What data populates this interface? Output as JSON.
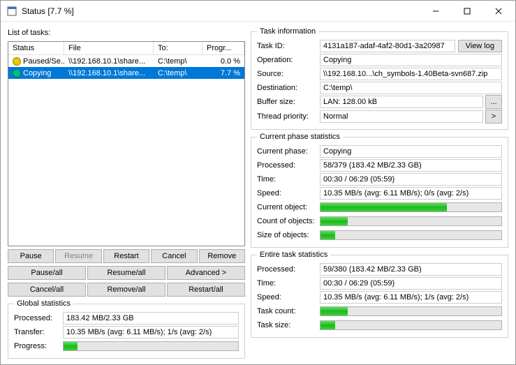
{
  "window": {
    "title": "Status [7.7 %]"
  },
  "tasksLabel": "List of tasks:",
  "listHeaders": {
    "status": "Status",
    "file": "File",
    "to": "To:",
    "progress": "Progr..."
  },
  "tasks": [
    {
      "status": "Paused/Se...",
      "file": "\\\\192.168.10.1\\share...",
      "to": "C:\\temp\\",
      "progress": "0.0 %",
      "state": "paused"
    },
    {
      "status": "Copying",
      "file": "\\\\192.168.10.1\\share...",
      "to": "C:\\temp\\",
      "progress": "7.7 %",
      "state": "copying"
    }
  ],
  "btns": {
    "pause": "Pause",
    "resume": "Resume",
    "restart": "Restart",
    "cancel": "Cancel",
    "remove": "Remove",
    "pauseAll": "Pause/all",
    "resumeAll": "Resume/all",
    "advanced": "Advanced >",
    "cancelAll": "Cancel/all",
    "removeAll": "Remove/all",
    "restartAll": "Restart/all"
  },
  "glob": {
    "legend": "Global statistics",
    "processedK": "Processed:",
    "processedV": "183.42 MB/2.33 GB",
    "transferK": "Transfer:",
    "transferV": "10.35 MB/s (avg: 6.11 MB/s); 1/s (avg: 2/s)",
    "progressK": "Progress:",
    "progressPct": 8
  },
  "info": {
    "legend": "Task information",
    "taskIdK": "Task ID:",
    "taskIdV": "4131a187-adaf-4af2-80d1-3a20987",
    "viewLog": "View log",
    "operationK": "Operation:",
    "operationV": "Copying",
    "sourceK": "Source:",
    "sourceV": "\\\\192.168.10...\\ch_symbols-1.40Beta-svn687.zip",
    "destK": "Destination:",
    "destV": "C:\\temp\\",
    "bufferK": "Buffer size:",
    "bufferV": "LAN: 128.00 kB",
    "threadK": "Thread priority:",
    "threadV": "Normal"
  },
  "phase": {
    "legend": "Current phase statistics",
    "currentK": "Current phase:",
    "currentV": "Copying",
    "processedK": "Processed:",
    "processedV": "58/379 (183.42 MB/2.33 GB)",
    "timeK": "Time:",
    "timeV": "00:30 / 06:29 (05:59)",
    "speedK": "Speed:",
    "speedV": "10.35 MB/s (avg: 6.11 MB/s); 0/s (avg: 2/s)",
    "objK": "Current object:",
    "objPct": 70,
    "countK": "Count of objects:",
    "countPct": 15,
    "sizeK": "Size of objects:",
    "sizePct": 8
  },
  "entire": {
    "legend": "Entire task statistics",
    "processedK": "Processed:",
    "processedV": "59/380 (183.42 MB/2.33 GB)",
    "timeK": "Time:",
    "timeV": "00:30 / 06:29 (05:59)",
    "speedK": "Speed:",
    "speedV": "10.35 MB/s (avg: 6.11 MB/s); 1/s (avg: 2/s)",
    "taskCountK": "Task count:",
    "taskCountPct": 15,
    "taskSizeK": "Task size:",
    "taskSizePct": 8
  }
}
